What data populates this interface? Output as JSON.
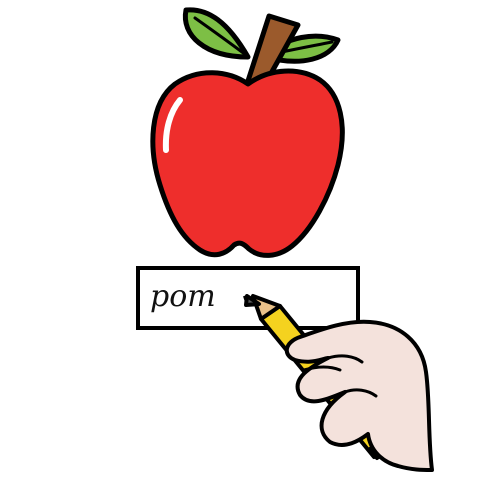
{
  "illustration": {
    "word": "pom",
    "subject": "apple-icon",
    "tool": "pencil-icon",
    "colors": {
      "background": "#ffffff",
      "outline": "#000000",
      "apple_red": "#ee2e2c",
      "leaf_green": "#7dbf45",
      "stem_brown": "#9b5a2c",
      "pencil_yellow": "#f4d21f",
      "pencil_tip": "#e5353f",
      "wood": "#e9c189",
      "graphite": "#5a5a5a",
      "skin": "#f4e2dc"
    }
  }
}
